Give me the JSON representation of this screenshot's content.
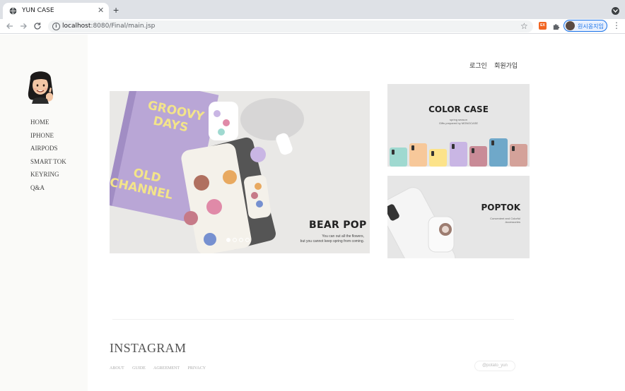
{
  "browser": {
    "tab_title": "YUN CASE",
    "tab_close": "✕",
    "new_tab": "+",
    "url_host": "localhost",
    "url_rest": ":8080/Final/main.jsp",
    "profile_name": "원시옹지임",
    "ext_label": "EX"
  },
  "header": {
    "login": "로그인",
    "signup": "회원가입"
  },
  "sidebar": {
    "items": [
      {
        "label": "HOME"
      },
      {
        "label": "IPHONE"
      },
      {
        "label": "AIRPODS"
      },
      {
        "label": "SMART TOK"
      },
      {
        "label": "KEYRING"
      },
      {
        "label": "Q&A"
      }
    ]
  },
  "hero": {
    "notebook_top": "GROOVY DAYS",
    "notebook_bottom": "OLD CHANNEL",
    "title": "BEAR POP",
    "subtitle_line1": "You can out all the flowers,",
    "subtitle_line2": "but you cannot keep spring from coming.",
    "slide_count": 4,
    "active_slide": 1
  },
  "banners": {
    "color_case": {
      "title": "COLOR CASE",
      "sub1": "spring season",
      "sub2": "Gifts prepared by MONOCASE",
      "colors": [
        "#9fd9d0",
        "#f7c89a",
        "#fce38a",
        "#c9b6e4",
        "#c98b97",
        "#6fa8c9",
        "#d4a29a"
      ]
    },
    "poptok": {
      "title": "POPTOK",
      "sub1": "Convenient and Colorful",
      "sub2": "Accessories"
    }
  },
  "footer": {
    "instagram": "INSTAGRAM",
    "links": [
      "ABOUT",
      "GUIDE",
      "AGREEMENT",
      "PRIVACY"
    ],
    "handle": "@potato_yun"
  },
  "colors": {
    "sidebar_bg": "#fafaf8",
    "chrome_bg": "#dee1e6",
    "notebook": "#b9a6d6",
    "notebook_text": "#f3e48a"
  }
}
